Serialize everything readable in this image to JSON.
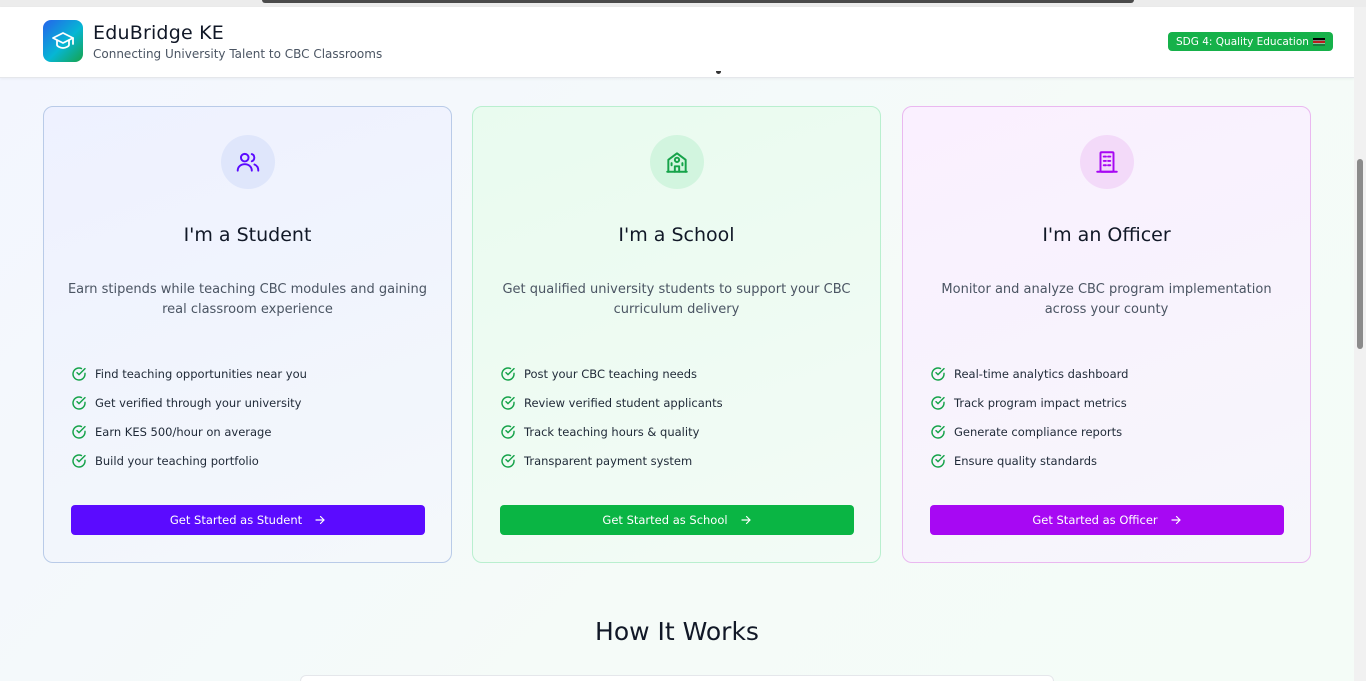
{
  "header": {
    "title": "EduBridge KE",
    "subtitle": "Connecting University Talent to CBC Classrooms",
    "badge": "SDG 4: Quality Education",
    "logo_icon": "graduation-cap-icon"
  },
  "colors": {
    "student_accent": "#5b0bff",
    "school_accent": "#0ab544",
    "officer_accent": "#a708f3",
    "check_green": "#16a34a"
  },
  "cards": [
    {
      "icon": "users-icon",
      "title": "I'm a Student",
      "description": "Earn stipends while teaching CBC modules and gaining real classroom experience",
      "features": [
        "Find teaching opportunities near you",
        "Get verified through your university",
        "Earn KES 500/hour on average",
        "Build your teaching portfolio"
      ],
      "cta": "Get Started as Student"
    },
    {
      "icon": "school-building-icon",
      "title": "I'm a School",
      "description": "Get qualified university students to support your CBC curriculum delivery",
      "features": [
        "Post your CBC teaching needs",
        "Review verified student applicants",
        "Track teaching hours & quality",
        "Transparent payment system"
      ],
      "cta": "Get Started as School"
    },
    {
      "icon": "office-building-icon",
      "title": "I'm an Officer",
      "description": "Monitor and analyze CBC program implementation across your county",
      "features": [
        "Real-time analytics dashboard",
        "Track program impact metrics",
        "Generate compliance reports",
        "Ensure quality standards"
      ],
      "cta": "Get Started as Officer"
    }
  ],
  "how_it_works": {
    "title": "How It Works"
  }
}
